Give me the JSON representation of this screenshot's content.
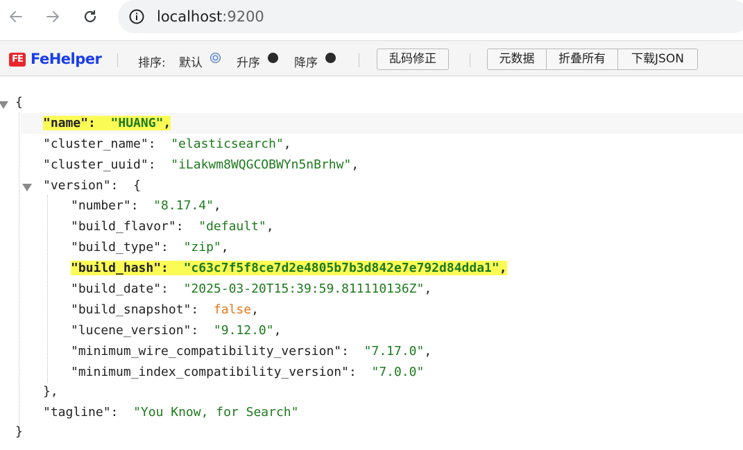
{
  "browser": {
    "url_host": "localhost",
    "url_port": ":9200"
  },
  "toolbar": {
    "brand": "FeHelper",
    "logo_text": "FE",
    "sort_label": "排序:",
    "sort_default": "默认",
    "sort_asc": "升序",
    "sort_desc": "降序",
    "fix_encoding": "乱码修正",
    "metadata": "元数据",
    "collapse_all": "折叠所有",
    "download_json": "下载JSON",
    "selected_sort": "默认"
  },
  "json": {
    "open_brace": "{",
    "close_brace": "}",
    "version_close": "},",
    "name_key": "\"name\"",
    "name_val": "\"HUANG\"",
    "cluster_name_key": "\"cluster_name\"",
    "cluster_name_val": "\"elasticsearch\"",
    "cluster_uuid_key": "\"cluster_uuid\"",
    "cluster_uuid_val": "\"iLakwm8WQGCOBWYn5nBrhw\"",
    "version_key": "\"version\"",
    "number_key": "\"number\"",
    "number_val": "\"8.17.4\"",
    "build_flavor_key": "\"build_flavor\"",
    "build_flavor_val": "\"default\"",
    "build_type_key": "\"build_type\"",
    "build_type_val": "\"zip\"",
    "build_hash_key": "\"build_hash\"",
    "build_hash_val": "\"c63c7f5f8ce7d2e4805b7b3d842e7e792d84dda1\"",
    "build_date_key": "\"build_date\"",
    "build_date_val": "\"2025-03-20T15:39:59.811110136Z\"",
    "build_snapshot_key": "\"build_snapshot\"",
    "build_snapshot_val": "false",
    "lucene_version_key": "\"lucene_version\"",
    "lucene_version_val": "\"9.12.0\"",
    "min_wire_key": "\"minimum_wire_compatibility_version\"",
    "min_wire_val": "\"7.17.0\"",
    "min_index_key": "\"minimum_index_compatibility_version\"",
    "min_index_val": "\"7.0.0\"",
    "tagline_key": "\"tagline\"",
    "tagline_val": "\"You Know, for Search\""
  },
  "colors": {
    "string": "#1d7a1d",
    "boolean": "#e8761a",
    "highlight": "#fbfb56",
    "brand": "#1a3ee8"
  }
}
